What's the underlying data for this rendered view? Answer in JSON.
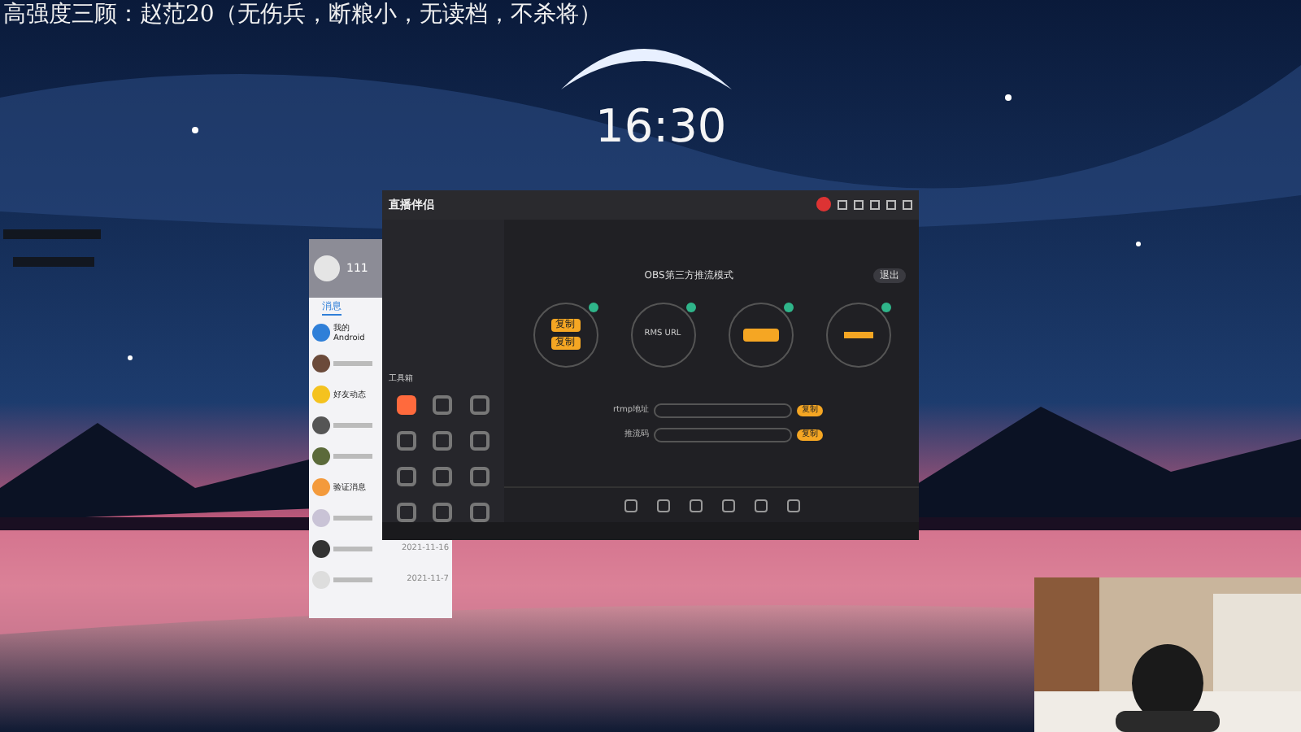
{
  "overlay_title": "高强度三顾：赵范20（无伤兵，断粮小，无读档，不杀将）",
  "clock": "16:30",
  "streaming_app": {
    "logo": "直播伴侣",
    "toolbox_label": "工具箱",
    "tools": [
      {
        "selected": true
      },
      {
        "selected": false
      },
      {
        "selected": false
      },
      {
        "selected": false
      },
      {
        "selected": false
      },
      {
        "selected": false
      },
      {
        "selected": false
      },
      {
        "selected": false
      },
      {
        "selected": false
      },
      {
        "selected": false
      },
      {
        "selected": false
      },
      {
        "selected": false
      }
    ],
    "mode_title": "OBS第三方推流模式",
    "exit_button": "退出",
    "steps": [
      {
        "kind": "buttons",
        "texts": [
          "复制",
          "复制"
        ]
      },
      {
        "kind": "lines",
        "texts": [
          "RMS URL"
        ]
      },
      {
        "kind": "buttons"
      },
      {
        "kind": "lines"
      }
    ],
    "fields": [
      {
        "label": "rtmp地址",
        "button": "复制"
      },
      {
        "label": "推流码",
        "button": "复制"
      }
    ]
  },
  "chat_app": {
    "profile_name": "111",
    "tab": "消息",
    "items": [
      {
        "name": "我的Android",
        "color": "#2f7fd8"
      },
      {
        "color": "#6b4a3a"
      },
      {
        "name": "好友动态",
        "color": "#f4c21f"
      },
      {
        "color": "#555555"
      },
      {
        "color": "#5b6a3a"
      },
      {
        "name": "验证消息",
        "color": "#f39a3c"
      },
      {
        "color": "#c9c3d6"
      },
      {
        "date": "2021-11-16",
        "color": "#333333"
      },
      {
        "date": "2021-11-7",
        "color": "#dddddd"
      }
    ]
  }
}
